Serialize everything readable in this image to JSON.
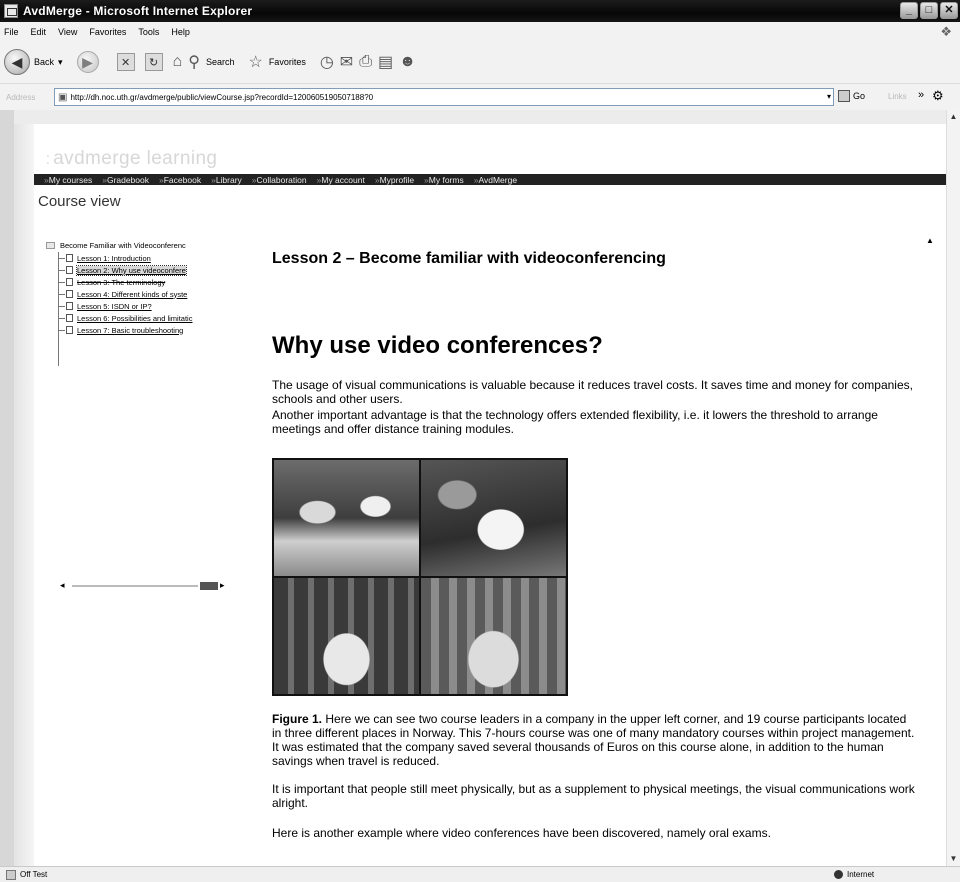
{
  "window": {
    "title": "AvdMerge - Microsoft Internet Explorer",
    "buttons": {
      "minimize": "_",
      "maximize": "□",
      "close": "✕"
    }
  },
  "menu": [
    "File",
    "Edit",
    "View",
    "Favorites",
    "Tools",
    "Help"
  ],
  "toolbar": {
    "back_label": "Back",
    "search_label": "Search",
    "favorites_label": "Favorites"
  },
  "address": {
    "label": "Address",
    "url": "http://dh.noc.uth.gr/avdmerge/public/viewCourse.jsp?recordId=1200605190507188?0",
    "go_label": "Go",
    "links_label": "Links"
  },
  "site": {
    "logo": "avdmerge learning",
    "nav": [
      "My courses",
      "Gradebook",
      "Facebook",
      "Library",
      "Collaboration",
      "My account",
      "Myprofile",
      "My forms",
      "AvdMerge"
    ],
    "page_title": "Course view"
  },
  "tree": {
    "root": "Become Familiar with Videoconferenc",
    "items": [
      "Lesson 1: Introduction",
      "Lesson 2: Why use videoconfere",
      "Lesson 3: The terminology",
      "Lesson 4: Different kinds of syste",
      "Lesson 5: ISDN or IP?",
      "Lesson 6: Possibilities and limitatic",
      "Lesson 7: Basic troubleshooting"
    ],
    "active_index": 1
  },
  "content": {
    "lesson_heading": "Lesson 2 – Become familiar with videoconferencing",
    "section_title": "Why use video conferences?",
    "p1": "The usage of visual communications is valuable because it reduces travel costs. It saves time and money for companies, schools and other users.",
    "p2": "Another important advantage is that the technology offers extended flexibility, i.e. it lowers the threshold to arrange meetings and offer distance training modules.",
    "figure_label": "Figure 1.",
    "figure_caption": " Here we can see two course leaders in a company in the upper left corner, and 19 course participants located in three different places in Norway. This 7-hours course was one of many mandatory courses within project management. It was estimated that the company saved several thousands of Euros on this course alone, in addition to the human savings when travel is reduced.",
    "p4": "It is important that people still meet physically, but as a supplement to physical meetings, the visual communications work alright.",
    "p5": "Here is another example where video conferences have been discovered, namely oral exams."
  },
  "status": {
    "left": "Off Test",
    "zone": "Internet"
  }
}
